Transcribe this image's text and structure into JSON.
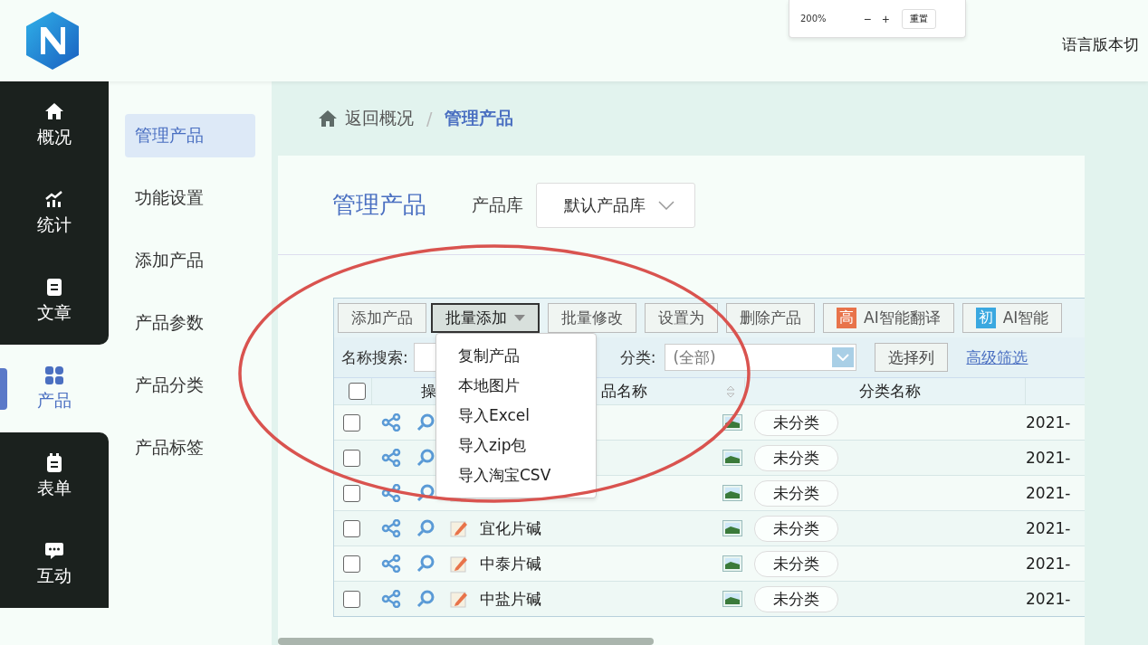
{
  "zoom_popup": {
    "value": "200%",
    "minus": "−",
    "plus": "+",
    "reset": "重置"
  },
  "header": {
    "language_switch": "语言版本切"
  },
  "nav": [
    {
      "label": "概况",
      "selected": false
    },
    {
      "label": "统计",
      "selected": false
    },
    {
      "label": "文章",
      "selected": false
    },
    {
      "label": "产品",
      "selected": true
    },
    {
      "label": "表单",
      "selected": false
    },
    {
      "label": "互动",
      "selected": false
    }
  ],
  "submenu": [
    {
      "label": "管理产品",
      "selected": true
    },
    {
      "label": "功能设置",
      "selected": false
    },
    {
      "label": "添加产品",
      "selected": false
    },
    {
      "label": "产品参数",
      "selected": false
    },
    {
      "label": "产品分类",
      "selected": false
    },
    {
      "label": "产品标签",
      "selected": false
    }
  ],
  "breadcrumb": {
    "back": "返回概况",
    "separator": "/",
    "current": "管理产品"
  },
  "page": {
    "title": "管理产品",
    "library_label": "产品库",
    "library_value": "默认产品库"
  },
  "toolbar": [
    {
      "kind": "plain",
      "label": "添加产品"
    },
    {
      "kind": "dropdown",
      "label": "批量添加",
      "expanded": true
    },
    {
      "kind": "plain",
      "label": "批量修改"
    },
    {
      "kind": "plain",
      "label": "设置为"
    },
    {
      "kind": "plain",
      "label": "删除产品"
    },
    {
      "kind": "badge",
      "badge": "高",
      "color": "#e8734a",
      "label": "AI智能翻译"
    },
    {
      "kind": "badge",
      "badge": "初",
      "color": "#3aa8e0",
      "label": "AI智能"
    }
  ],
  "dropdown_menu": [
    "复制产品",
    "本地图片",
    "导入Excel",
    "导入zip包",
    "导入淘宝CSV"
  ],
  "filter": {
    "search_label": "名称搜索:",
    "category_label": "分类:",
    "category_value": "(全部)",
    "columns_button": "选择列",
    "advanced_link": "高级筛选"
  },
  "table": {
    "select_all_checked": false,
    "columns": [
      "操",
      "品名称",
      "分类名称"
    ],
    "rows": [
      {
        "checked": false,
        "category": "未分类",
        "date": "2021-"
      },
      {
        "checked": false,
        "category": "未分类",
        "date": "2021-"
      },
      {
        "checked": false,
        "category": "未分类",
        "date": "2021-"
      },
      {
        "checked": false,
        "name": "宜化片碱",
        "category": "未分类",
        "date": "2021-"
      },
      {
        "checked": false,
        "name": "中泰片碱",
        "category": "未分类",
        "date": "2021-"
      },
      {
        "checked": false,
        "name": "中盐片碱",
        "category": "未分类",
        "date": "2021-"
      }
    ]
  }
}
